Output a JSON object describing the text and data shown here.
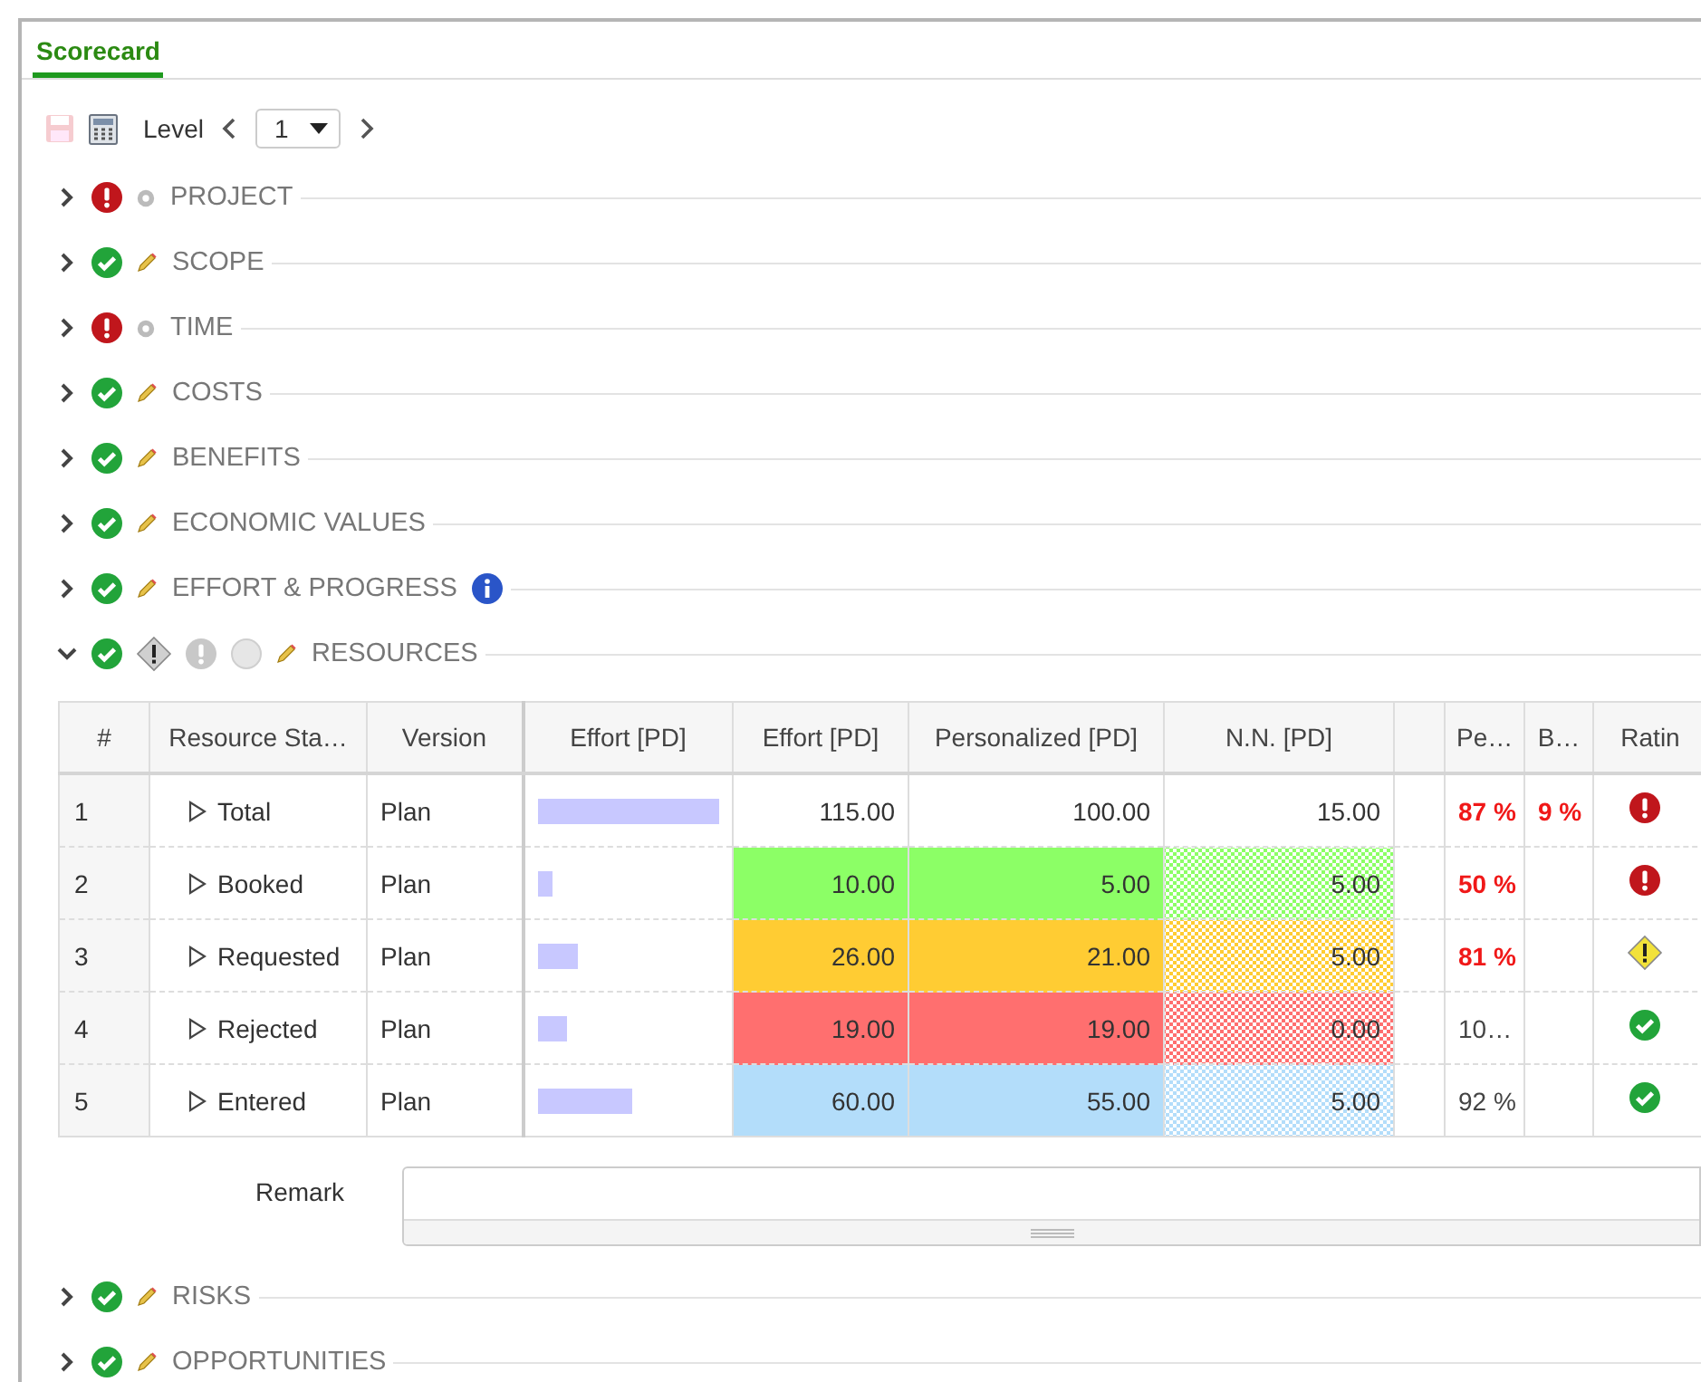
{
  "tab": {
    "label": "Scorecard",
    "selected": true
  },
  "toolbar": {
    "level_label": "Level",
    "level_value": "1",
    "save_disabled": true
  },
  "sections": [
    {
      "title": "PROJECT",
      "expanded": false,
      "status_icon": {
        "kind": "error"
      },
      "mode_icon": {
        "kind": "gear"
      }
    },
    {
      "title": "SCOPE",
      "expanded": false,
      "status_icon": {
        "kind": "ok"
      },
      "mode_icon": {
        "kind": "pencil"
      }
    },
    {
      "title": "TIME",
      "expanded": false,
      "status_icon": {
        "kind": "error"
      },
      "mode_icon": {
        "kind": "gear"
      }
    },
    {
      "title": "COSTS",
      "expanded": false,
      "status_icon": {
        "kind": "ok"
      },
      "mode_icon": {
        "kind": "pencil"
      }
    },
    {
      "title": "BENEFITS",
      "expanded": false,
      "status_icon": {
        "kind": "ok"
      },
      "mode_icon": {
        "kind": "pencil"
      }
    },
    {
      "title": "ECONOMIC VALUES",
      "expanded": false,
      "status_icon": {
        "kind": "ok"
      },
      "mode_icon": {
        "kind": "pencil"
      }
    },
    {
      "title": "EFFORT & PROGRESS",
      "expanded": false,
      "status_icon": {
        "kind": "ok"
      },
      "mode_icon": {
        "kind": "pencil"
      },
      "info": true
    },
    {
      "title": "RESOURCES",
      "expanded": true,
      "status_icon": {
        "kind": "ok"
      },
      "mode_icon": {
        "kind": "pencil"
      },
      "filters": [
        {
          "kind": "warning"
        },
        {
          "kind": "error"
        },
        {
          "kind": "none"
        }
      ],
      "table": {
        "columns": [
          "#",
          "Resource Sta…",
          "Version",
          "Effort [PD]",
          "Effort [PD]",
          "Personalized [PD]",
          "N.N. [PD]",
          "Pe…",
          "B…",
          "Ratin"
        ],
        "rows": [
          {
            "num": "1",
            "name": "Total",
            "version": "Plan",
            "effort": "115.00",
            "personalized": "100.00",
            "nn": "15.00",
            "pe": "87 %",
            "pe_alert": true,
            "b": "9 %",
            "rating": {
              "kind": "error"
            }
          },
          {
            "num": "2",
            "name": "Booked",
            "version": "Plan",
            "color": "#8cff66",
            "effort": "10.00",
            "personalized": "5.00",
            "nn": "5.00",
            "pe": "50 %",
            "pe_alert": true,
            "rating": {
              "kind": "error"
            }
          },
          {
            "num": "3",
            "name": "Requested",
            "version": "Plan",
            "color": "#ffcc33",
            "effort": "26.00",
            "personalized": "21.00",
            "nn": "5.00",
            "pe": "81 %",
            "pe_alert": true,
            "rating": {
              "kind": "warning"
            }
          },
          {
            "num": "4",
            "name": "Rejected",
            "version": "Plan",
            "color": "#ff6f6f",
            "effort": "19.00",
            "personalized": "19.00",
            "nn": "0.00",
            "pe": "10…",
            "pe_alert": false,
            "rating": {
              "kind": "ok"
            }
          },
          {
            "num": "5",
            "name": "Entered",
            "version": "Plan",
            "color": "#b3ddfa",
            "effort": "60.00",
            "personalized": "55.00",
            "nn": "5.00",
            "pe": "92 %",
            "pe_alert": false,
            "rating": {
              "kind": "ok"
            }
          }
        ]
      },
      "remark": {
        "label": "Remark"
      }
    },
    {
      "title": "RISKS",
      "expanded": false,
      "status_icon": {
        "kind": "ok"
      },
      "mode_icon": {
        "kind": "pencil"
      }
    },
    {
      "title": "OPPORTUNITIES",
      "expanded": false,
      "status_icon": {
        "kind": "ok"
      },
      "mode_icon": {
        "kind": "pencil"
      }
    }
  ]
}
